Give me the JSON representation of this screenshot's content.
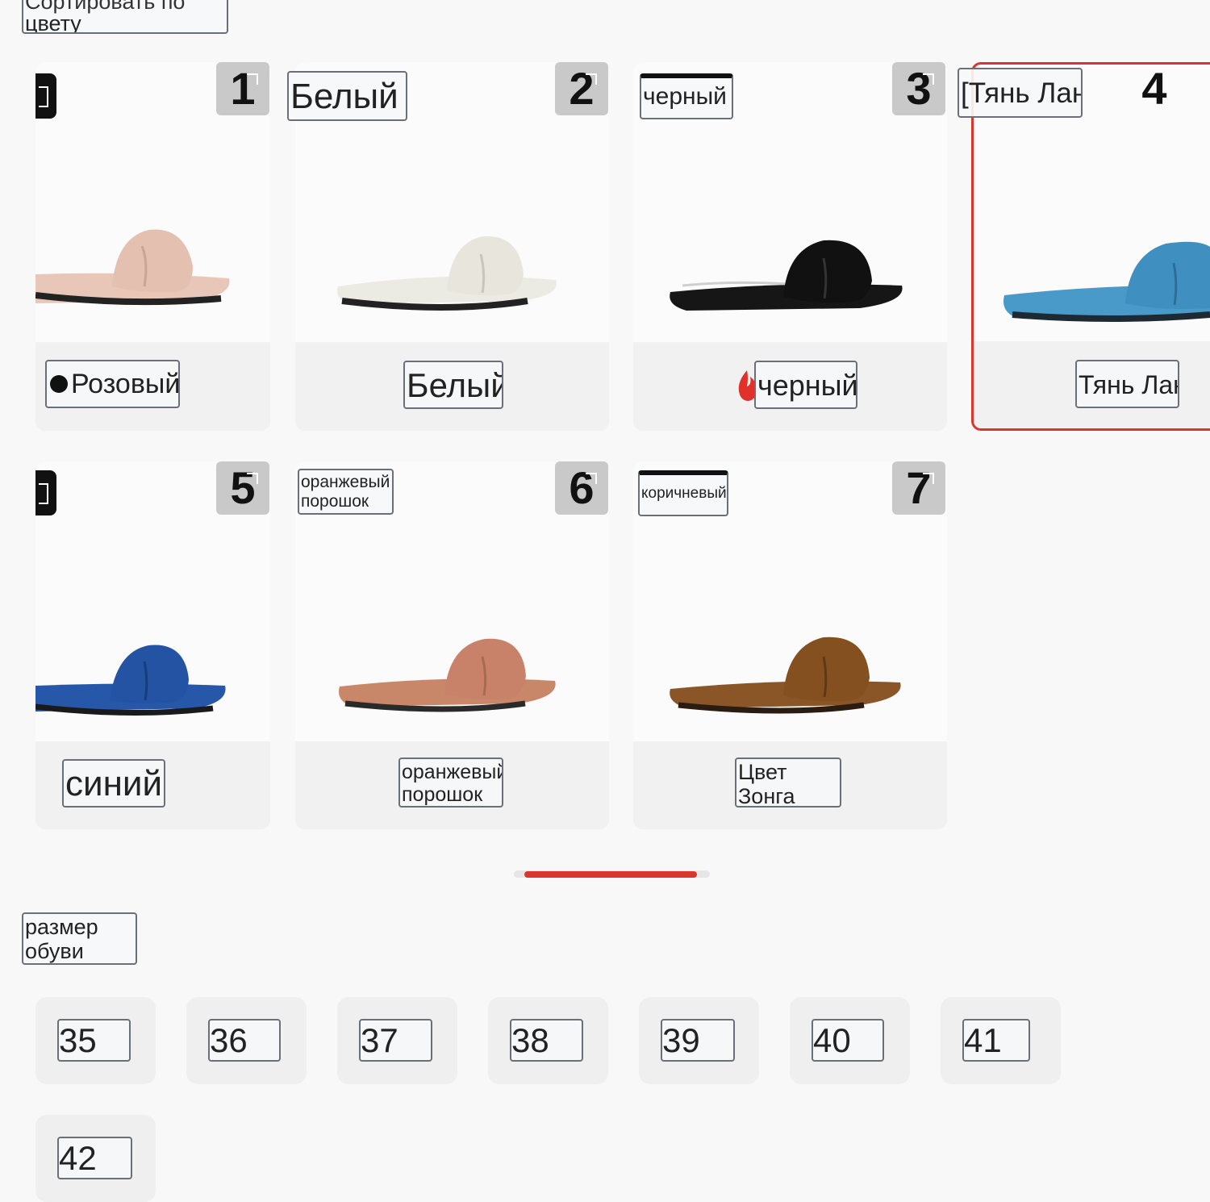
{
  "header": {
    "sort_label_line1": "Сортировать по",
    "sort_label_line2": "цвету"
  },
  "colors": {
    "accent": "#d9372e",
    "pink": "#e8c7b9",
    "white": "#ecebe3",
    "black": "#151515",
    "tian_lan": "#4a9ac9",
    "blue": "#2657a8",
    "orange_powder": "#c9876a",
    "zong": "#8a5527"
  },
  "colors_list": [
    {
      "number": "1",
      "top_label": "",
      "caption": "Розовый",
      "slipper_color": "pink"
    },
    {
      "number": "2",
      "top_label": "Белый",
      "caption": "Белый",
      "slipper_color": "white"
    },
    {
      "number": "3",
      "top_label": "черный",
      "caption": "черный",
      "slipper_color": "black"
    },
    {
      "number": "4",
      "top_label": "[Тянь Лан",
      "caption": "Тянь Лан",
      "slipper_color": "tian_lan",
      "selected": true
    },
    {
      "number": "5",
      "top_label": "",
      "caption": "синий",
      "slipper_color": "blue"
    },
    {
      "number": "6",
      "top_label_line1": "оранжевый",
      "top_label_line2": "порошок",
      "caption_line1": "оранжевый",
      "caption_line2": "порошок",
      "slipper_color": "orange_powder"
    },
    {
      "number": "7",
      "top_label": "коричневый",
      "caption_line1": "Цвет",
      "caption_line2": "Зонга",
      "slipper_color": "zong"
    }
  ],
  "sizes": {
    "title_line1": "размер",
    "title_line2": "обуви",
    "values": [
      "35",
      "36",
      "37",
      "38",
      "39",
      "40",
      "41",
      "42"
    ]
  }
}
